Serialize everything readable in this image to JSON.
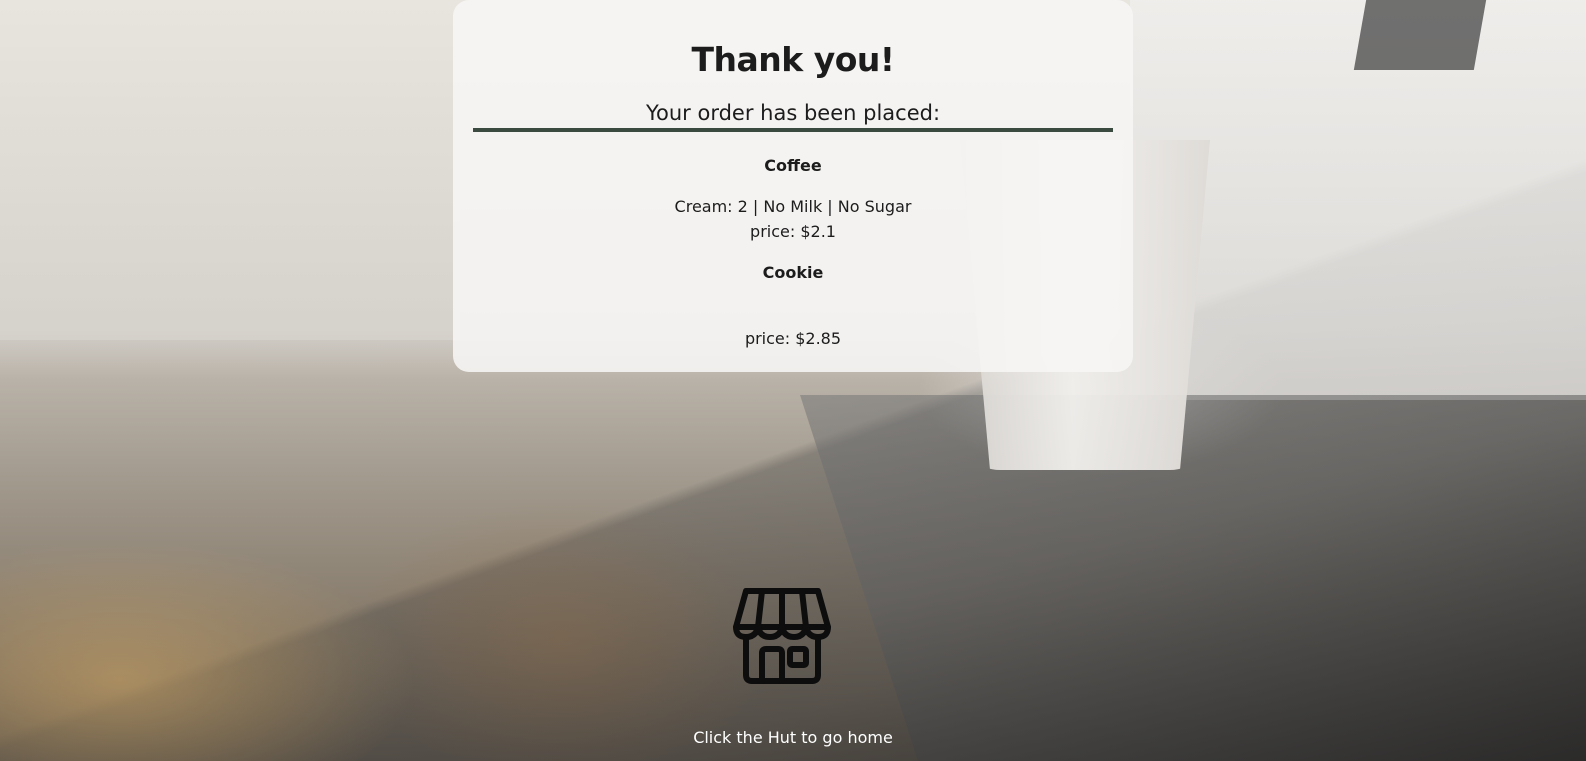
{
  "confirmation": {
    "title": "Thank you!",
    "subtitle": "Your order has been placed:"
  },
  "order": {
    "items": [
      {
        "name": "Coffee",
        "options": "Cream: 2 | No Milk | No Sugar",
        "price": "price: $2.1"
      },
      {
        "name": "Cookie",
        "options": "",
        "price": "price: $2.85"
      }
    ]
  },
  "footer": {
    "home_icon": "store-hut-icon",
    "caption": "Click the Hut to go home"
  },
  "colors": {
    "divider": "#3a4a40",
    "text": "#1c1c1c",
    "caption": "#ffffff"
  }
}
